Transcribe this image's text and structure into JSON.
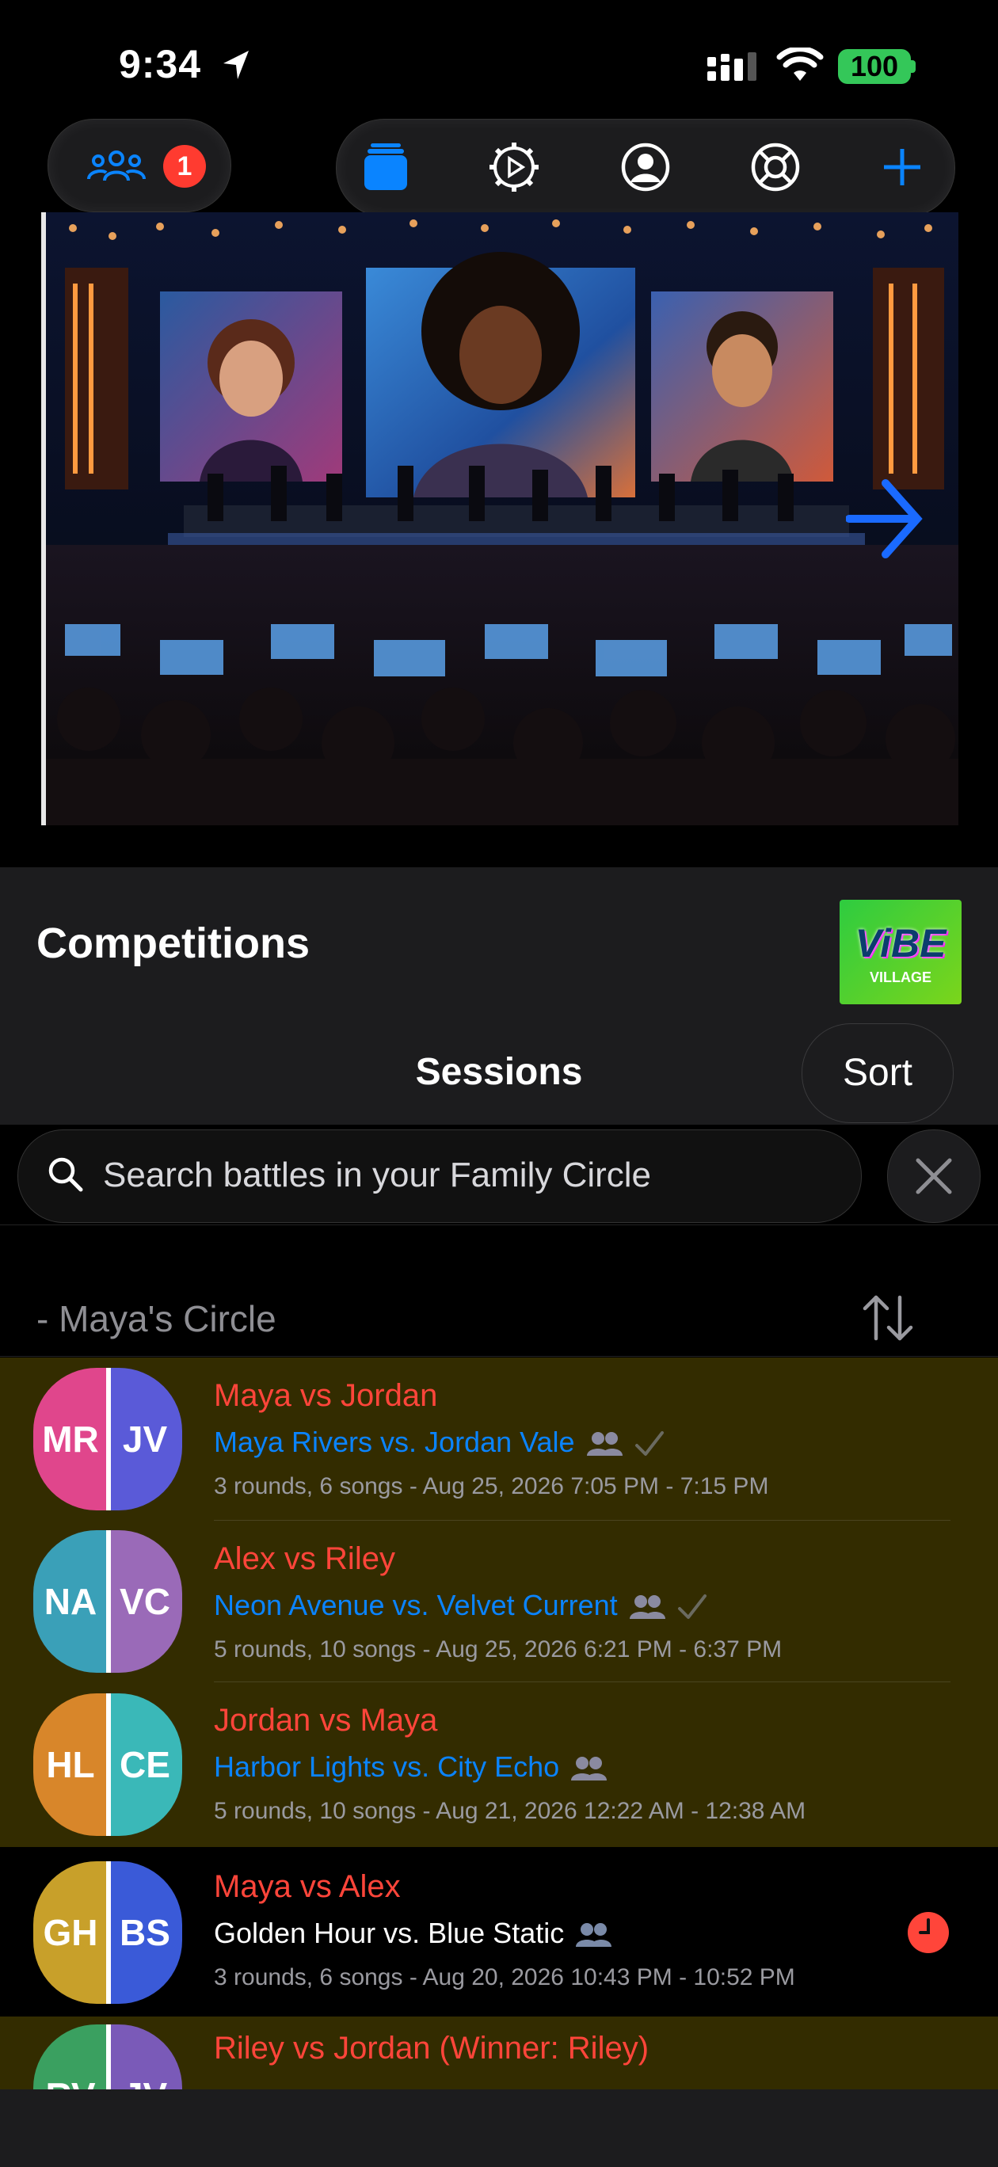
{
  "status_bar": {
    "time": "9:34",
    "battery": "100"
  },
  "toolbar": {
    "friends_badge": "1"
  },
  "competitions": {
    "title": "Competitions",
    "logo_text": "ViBE",
    "logo_subtext": "VILLAGE",
    "sessions_label": "Sessions",
    "sort_label": "Sort"
  },
  "search": {
    "placeholder": "Search battles in your Family Circle"
  },
  "section": {
    "title": "- Maya's Circle"
  },
  "colors": {
    "accent": "#0a84ff",
    "title_red": "#ff453a",
    "highlight_row": "#332c00",
    "badge": "#ff3b30"
  },
  "rows": [
    {
      "title": "Maya vs Jordan",
      "subtitle": "Maya Rivers vs. Jordan Vale",
      "meta": "3 rounds, 6 songs - Aug 25, 2026 7:05 PM - 7:15 PM",
      "left_initials": "MR",
      "right_initials": "JV",
      "left_color": "#e0468c",
      "right_color": "#5a5ad8",
      "checked": true,
      "highlighted": true
    },
    {
      "title": "Alex vs Riley",
      "subtitle": "Neon Avenue vs. Velvet Current",
      "meta": "5 rounds, 10 songs - Aug 25, 2026 6:21 PM - 6:37 PM",
      "left_initials": "NA",
      "right_initials": "VC",
      "left_color": "#3aa0b8",
      "right_color": "#9a6ab8",
      "checked": true,
      "highlighted": true
    },
    {
      "title": "Jordan vs Maya",
      "subtitle": "Harbor Lights vs. City Echo",
      "meta": "5 rounds, 10 songs - Aug 21, 2026 12:22 AM - 12:38 AM",
      "left_initials": "HL",
      "right_initials": "CE",
      "left_color": "#d8862a",
      "right_color": "#3ab8b8",
      "checked": false,
      "highlighted": true
    },
    {
      "title": "Maya vs Alex",
      "subtitle": "Golden Hour vs. Blue Static",
      "meta": "3 rounds, 6 songs - Aug 20, 2026 10:43 PM - 10:52 PM",
      "left_initials": "GH",
      "right_initials": "BS",
      "left_color": "#c8a02a",
      "right_color": "#3a5ad8",
      "checked": false,
      "highlighted": false,
      "pending": true
    },
    {
      "title": "Riley vs Jordan (Winner: Riley)",
      "subtitle": "",
      "meta": "",
      "left_initials": "RV",
      "right_initials": "JV",
      "left_color": "#3aa060",
      "right_color": "#7a5ab8",
      "checked": false,
      "highlighted": true
    }
  ]
}
